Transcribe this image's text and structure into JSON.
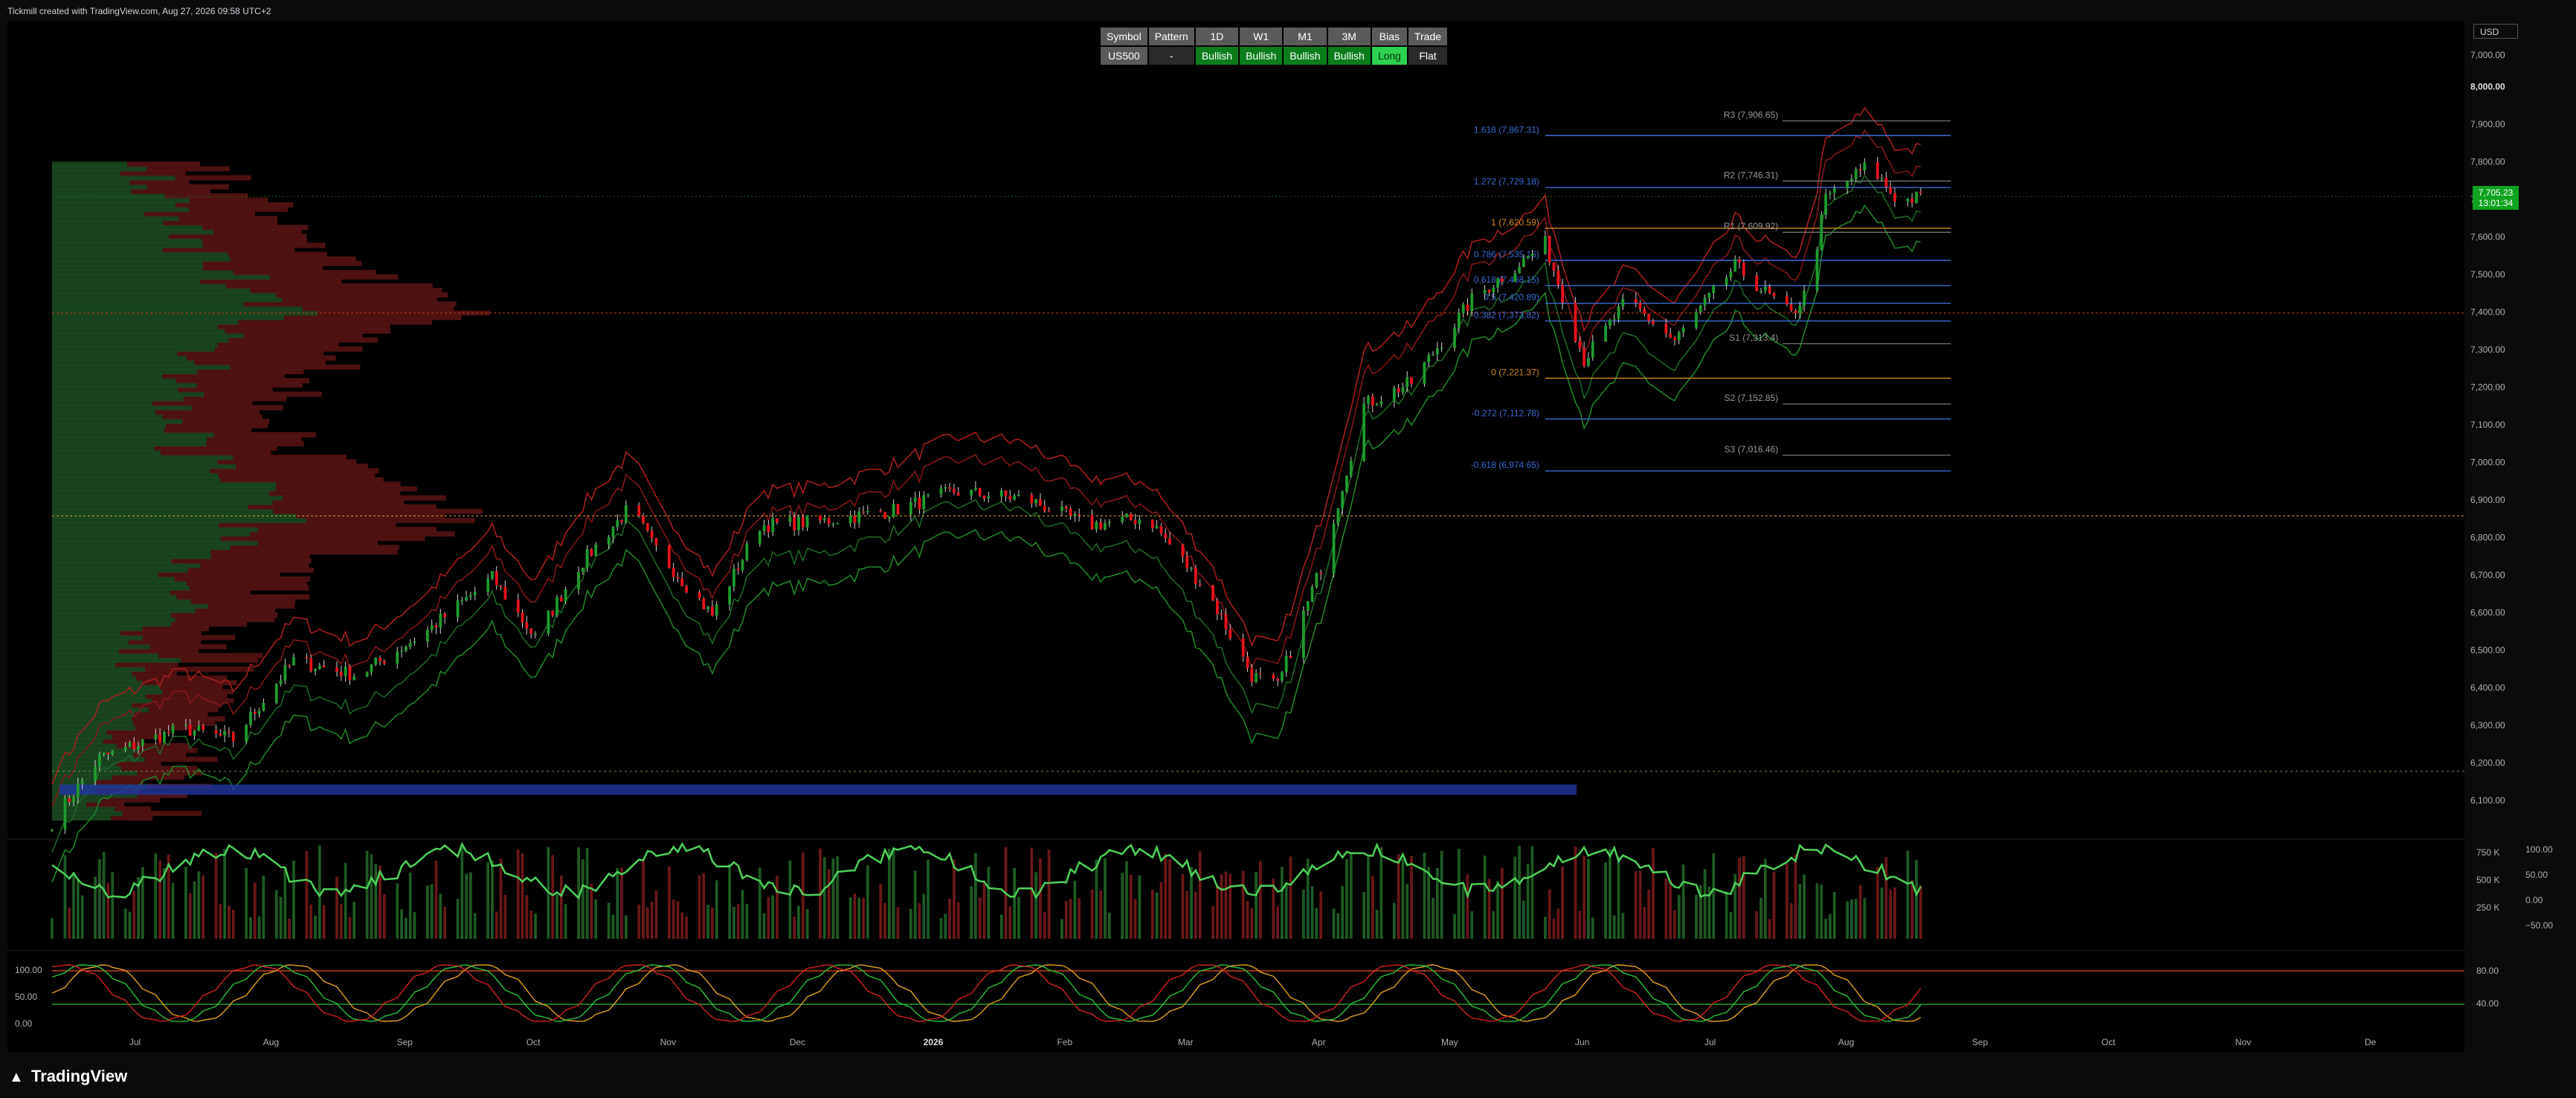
{
  "header": {
    "credit": "Tickmill created with TradingView.com, Aug 27, 2026 09:58 UTC+2"
  },
  "branding": {
    "logo_text": "TradingView",
    "logo_icon": "tradingview-logo-icon"
  },
  "currency": {
    "label": "USD"
  },
  "last_price": {
    "value": "7,705.23",
    "countdown": "13:01:34"
  },
  "colors": {
    "background": "#0b0b0b",
    "up": "#1f9c2c",
    "down": "#e8121a",
    "fib": "#3b6bd6",
    "pivot": "#8c8c8c",
    "bias_bullish": "#0b7d1a",
    "bias_long": "#2bd14f"
  },
  "bias_table": {
    "headers": [
      "Symbol",
      "Pattern",
      "1D",
      "W1",
      "M1",
      "3M",
      "Bias",
      "Trade"
    ],
    "row": [
      "US500",
      "-",
      "Bullish",
      "Bullish",
      "Bullish",
      "Bullish",
      "Long",
      "Flat"
    ]
  },
  "chart_data": {
    "type": "candlestick",
    "symbol": "US500",
    "x_range": [
      "2025-06-20",
      "2026-12-31"
    ],
    "ylim": [
      6050,
      8050
    ],
    "grid": false,
    "price_axis": [
      "7,000.00",
      "7,900.00",
      "7,800.00",
      "7,700.00",
      "7,600.00",
      "7,500.00",
      "7,400.00",
      "7,300.00",
      "7,200.00",
      "7,100.00",
      "7,000.00",
      "6,900.00",
      "6,800.00",
      "6,700.00",
      "6,600.00",
      "6,500.00",
      "6,400.00",
      "6,300.00",
      "6,200.00",
      "6,100.00"
    ],
    "price_axis_bold": [
      "8,000.00"
    ],
    "price_axis_values": [
      8000,
      7900,
      7800,
      7700,
      7600,
      7500,
      7400,
      7300,
      7200,
      7100,
      7000,
      6900,
      6800,
      6700,
      6600,
      6500,
      6400,
      6300,
      6200,
      6100
    ],
    "time_axis": [
      {
        "label": "Jul",
        "date": "2025-07-01"
      },
      {
        "label": "Aug",
        "date": "2025-08-01"
      },
      {
        "label": "Sep",
        "date": "2025-09-01"
      },
      {
        "label": "Oct",
        "date": "2025-10-01"
      },
      {
        "label": "Nov",
        "date": "2025-11-01"
      },
      {
        "label": "Dec",
        "date": "2025-12-01"
      },
      {
        "label": "2026",
        "date": "2026-01-01",
        "bold": true
      },
      {
        "label": "Feb",
        "date": "2026-02-01"
      },
      {
        "label": "Mar",
        "date": "2026-03-01"
      },
      {
        "label": "Apr",
        "date": "2026-04-01"
      },
      {
        "label": "May",
        "date": "2026-05-01"
      },
      {
        "label": "Jun",
        "date": "2026-06-01"
      },
      {
        "label": "Jul",
        "date": "2026-07-01"
      },
      {
        "label": "Aug",
        "date": "2026-08-01"
      },
      {
        "label": "Sep",
        "date": "2026-09-01"
      },
      {
        "label": "Oct",
        "date": "2026-10-01"
      },
      {
        "label": "Nov",
        "date": "2026-11-01"
      },
      {
        "label": "De",
        "date": "2026-12-01"
      }
    ],
    "close_path": [
      [
        "2025-06-20",
        6040
      ],
      [
        "2025-07-01",
        6210
      ],
      [
        "2025-07-20",
        6290
      ],
      [
        "2025-08-01",
        6260
      ],
      [
        "2025-08-15",
        6470
      ],
      [
        "2025-08-30",
        6430
      ],
      [
        "2025-09-15",
        6550
      ],
      [
        "2025-09-30",
        6690
      ],
      [
        "2025-10-10",
        6530
      ],
      [
        "2025-10-20",
        6720
      ],
      [
        "2025-11-01",
        6880
      ],
      [
        "2025-11-06",
        6780
      ],
      [
        "2025-11-20",
        6590
      ],
      [
        "2025-12-01",
        6830
      ],
      [
        "2025-12-15",
        6840
      ],
      [
        "2026-01-01",
        6870
      ],
      [
        "2026-01-15",
        6920
      ],
      [
        "2026-02-01",
        6900
      ],
      [
        "2026-02-15",
        6830
      ],
      [
        "2026-03-01",
        6850
      ],
      [
        "2026-03-15",
        6650
      ],
      [
        "2026-03-25",
        6430
      ],
      [
        "2026-03-31",
        6400
      ],
      [
        "2026-04-10",
        6720
      ],
      [
        "2026-04-20",
        7150
      ],
      [
        "2026-05-01",
        7210
      ],
      [
        "2026-05-15",
        7430
      ],
      [
        "2026-06-01",
        7580
      ],
      [
        "2026-06-10",
        7270
      ],
      [
        "2026-06-20",
        7430
      ],
      [
        "2026-07-01",
        7320
      ],
      [
        "2026-07-15",
        7520
      ],
      [
        "2026-07-28",
        7390
      ],
      [
        "2026-08-01",
        7460
      ],
      [
        "2026-08-05",
        7700
      ],
      [
        "2026-08-15",
        7790
      ],
      [
        "2026-08-22",
        7690
      ],
      [
        "2026-08-27",
        7705
      ]
    ],
    "fib_levels": [
      {
        "label": "1.618 (7,867.31)",
        "value": 7867.31
      },
      {
        "label": "1.272 (7,729.18)",
        "value": 7729.18
      },
      {
        "label": "1 (7,620.59)",
        "value": 7620.59
      },
      {
        "label": "0.786 (7,535.16)",
        "value": 7535.16
      },
      {
        "label": "0.618 (7,468.15)",
        "value": 7468.15
      },
      {
        "label": "0.5 (7,420.89)",
        "value": 7420.89
      },
      {
        "label": "0.382 (7,373.82)",
        "value": 7373.82
      },
      {
        "label": "0 (7,221.37)",
        "value": 7221.37
      },
      {
        "label": "-0.272 (7,112.78)",
        "value": 7112.78
      },
      {
        "label": "-0.618 (6,974.65)",
        "value": 6974.65
      }
    ],
    "pivot_levels": [
      {
        "label": "R3 (7,906.65)",
        "value": 7906.65
      },
      {
        "label": "R2 (7,746.31)",
        "value": 7746.31
      },
      {
        "label": "R1 (7,609.92)",
        "value": 7609.92
      },
      {
        "label": "S1 (7,313.4)",
        "value": 7313.4
      },
      {
        "label": "S2 (7,152.85)",
        "value": 7152.85
      },
      {
        "label": "S3 (7,016.46)",
        "value": 7016.46
      }
    ],
    "poc_level": 7395,
    "value_area_level": 6855,
    "support_level": 6175,
    "volume_axis": [
      "750 K",
      "500 K",
      "250 K"
    ],
    "rsi_axis": [
      "100.00",
      "50.00",
      "0.00",
      "−50.00"
    ],
    "stoch_axis_left": [
      "100.00",
      "50.00",
      "0.00"
    ],
    "stoch_axis_right": [
      "80.00",
      "40.00"
    ]
  }
}
